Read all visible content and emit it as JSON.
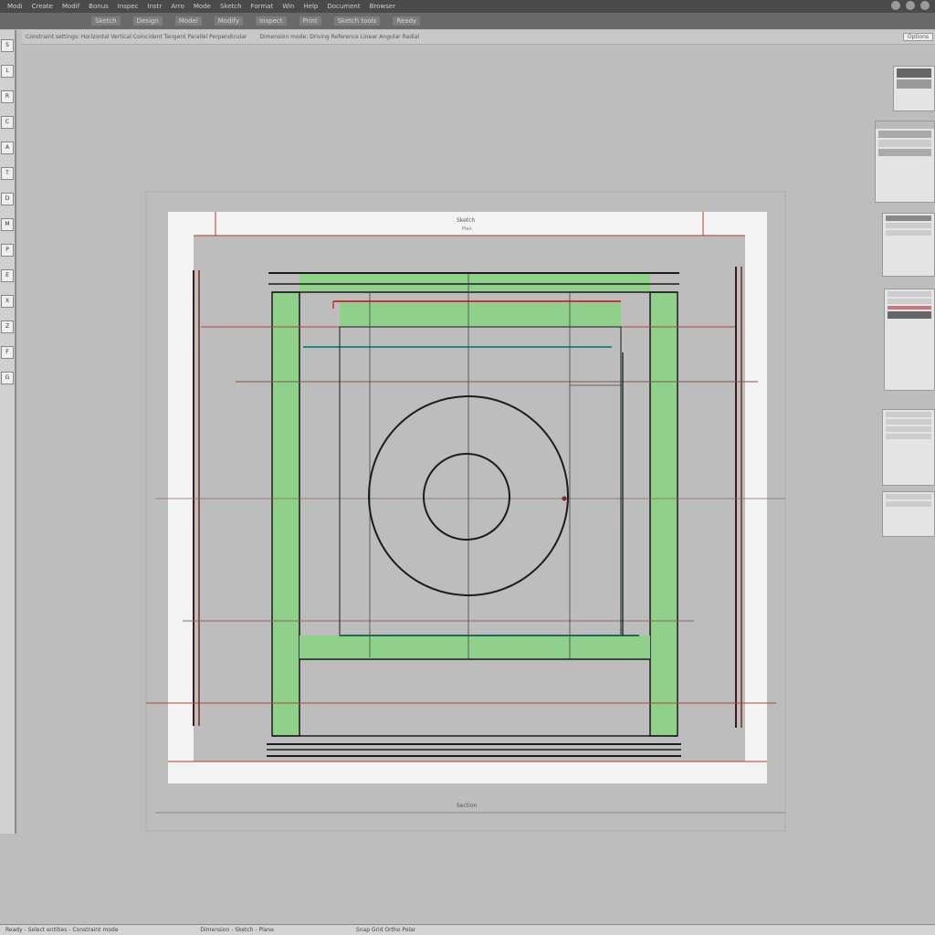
{
  "menubar": {
    "items": [
      "Modi",
      "Create",
      "Modif",
      "Bonus",
      "Inspec",
      "Instr",
      "Arro",
      "Mode",
      "Sketch",
      "Format",
      "Win",
      "Help",
      "Document",
      "Browser"
    ]
  },
  "toolbar": {
    "items": [
      "Sketch",
      "Design",
      "Model",
      "Modify",
      "Inspect",
      "Print",
      "Sketch tools",
      "Ready"
    ]
  },
  "optionsbar": {
    "left_text": "Constraint settings: Horizontal Vertical Coincident Tangent Parallel Perpendicular",
    "right_text": "Dimension mode: Driving Reference Linear Angular Radial",
    "button": "Options"
  },
  "tools": [
    "S",
    "L",
    "R",
    "C",
    "A",
    "T",
    "D",
    "M",
    "P",
    "E",
    "X",
    "Z",
    "F",
    "G"
  ],
  "drawing": {
    "title": "Sketch",
    "subtitle": "Plan",
    "bottom_label": "Section"
  },
  "status": [
    "Ready - Select entities - Constraint mode",
    "Dimension - Sketch - Plane",
    "Snap Grid Ortho Polar"
  ],
  "colors": {
    "green_fill": "#8fd08a",
    "red_line": "#c0392b",
    "teal_line": "#1f8a7d",
    "frame_white": "#f2f2f2"
  }
}
